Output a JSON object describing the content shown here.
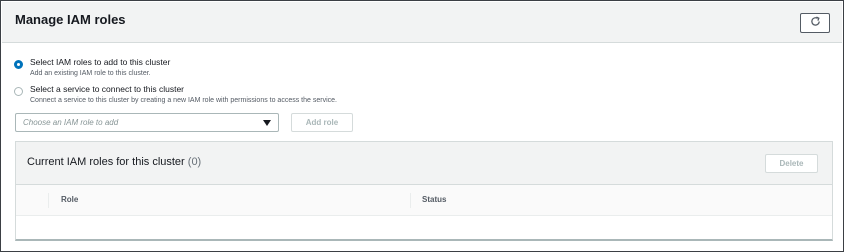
{
  "panel": {
    "title": "Manage IAM roles",
    "refresh_icon": "refresh-icon"
  },
  "options": [
    {
      "label": "Select IAM roles to add to this cluster",
      "description": "Add an existing IAM role to this cluster.",
      "selected": true
    },
    {
      "label": "Select a service to connect to this cluster",
      "description": "Connect a service to this cluster by creating a new IAM role with permissions to access the service.",
      "selected": false
    }
  ],
  "role_select": {
    "placeholder": "Choose an IAM role to add"
  },
  "add_role_label": "Add role",
  "current_roles": {
    "title": "Current IAM roles for this cluster",
    "count": "(0)",
    "delete_label": "Delete",
    "columns": [
      "Role",
      "Status"
    ]
  },
  "colors": {
    "accent": "#0073bb",
    "header_bg": "#f2f3f3",
    "disabled_text": "#aab7b8"
  }
}
